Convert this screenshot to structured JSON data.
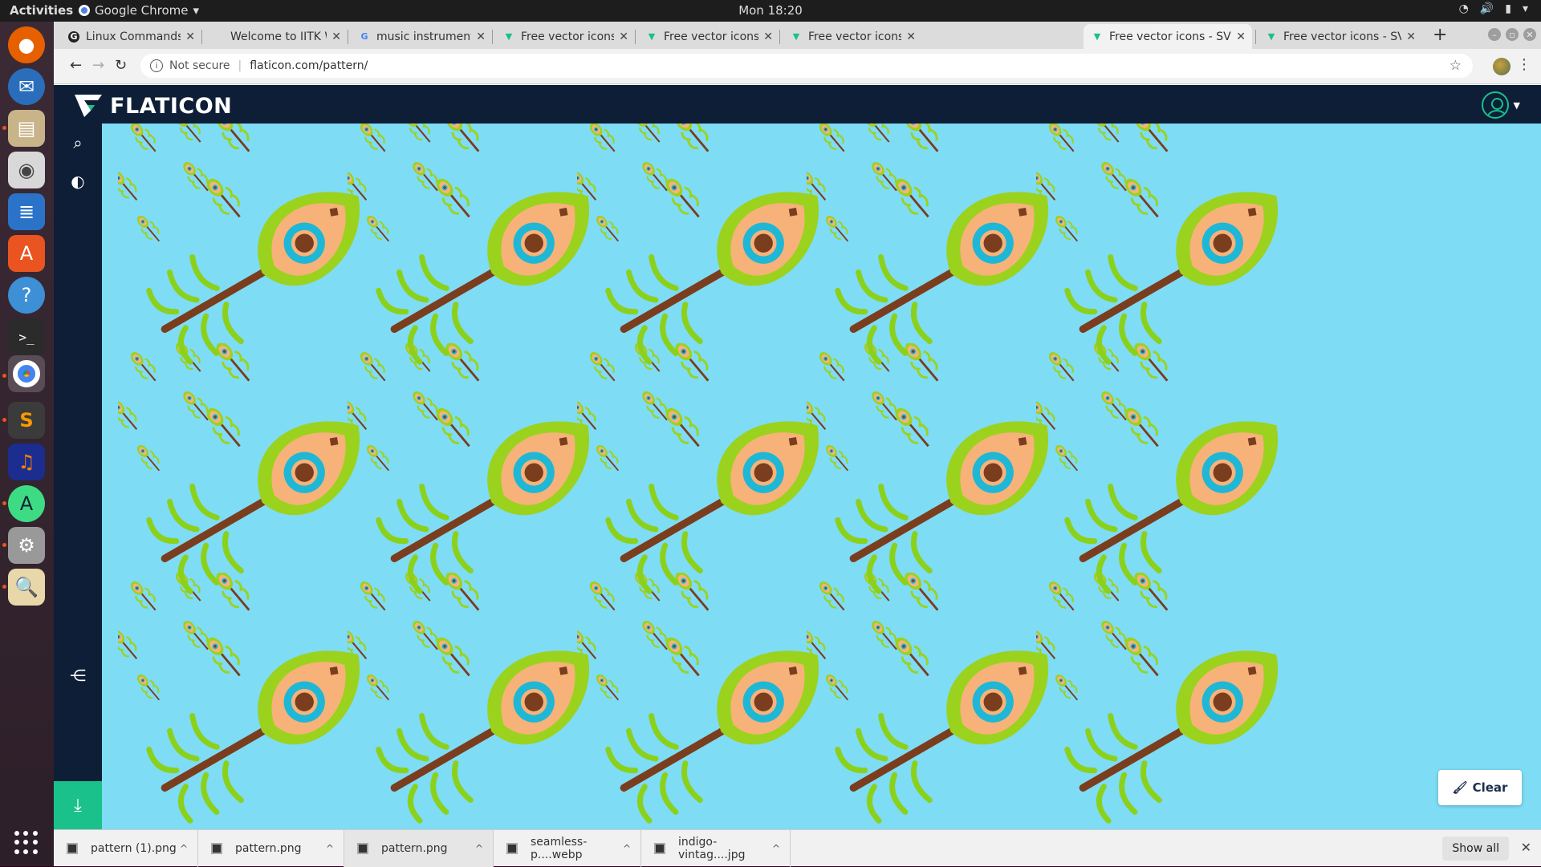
{
  "topbar": {
    "activities": "Activities",
    "app_name": "Google Chrome",
    "clock": "Mon 18:20"
  },
  "tabs": [
    {
      "title": "Linux Commands Che",
      "favicon": "G"
    },
    {
      "title": "Welcome to IITK Webr",
      "favicon": ""
    },
    {
      "title": "music instruments im",
      "favicon": "G"
    },
    {
      "title": "Free vector icons - SV",
      "favicon": "flaticon"
    },
    {
      "title": "Free vector icons - SV",
      "favicon": "flaticon"
    },
    {
      "title": "Free vector icons - SV",
      "favicon": "flaticon"
    },
    {
      "title": "Free vector icons - SV",
      "favicon": "flaticon",
      "active": true
    },
    {
      "title": "Free vector icons - SV",
      "favicon": "flaticon"
    }
  ],
  "address": {
    "security": "Not secure",
    "url": "flaticon.com/pattern/"
  },
  "flaticon": {
    "logo": "FLATICON",
    "clear_label": "Clear",
    "colors": {
      "header": "#0e1e37",
      "accent": "#1bc18a",
      "pattern_bg": "#7edcf5"
    }
  },
  "downloads": [
    {
      "name": "pattern (1).png"
    },
    {
      "name": "pattern.png"
    },
    {
      "name": "pattern.png"
    },
    {
      "name": "seamless-p....webp"
    },
    {
      "name": "indigo-vintag....jpg"
    }
  ],
  "download_bar": {
    "show_all": "Show all"
  }
}
